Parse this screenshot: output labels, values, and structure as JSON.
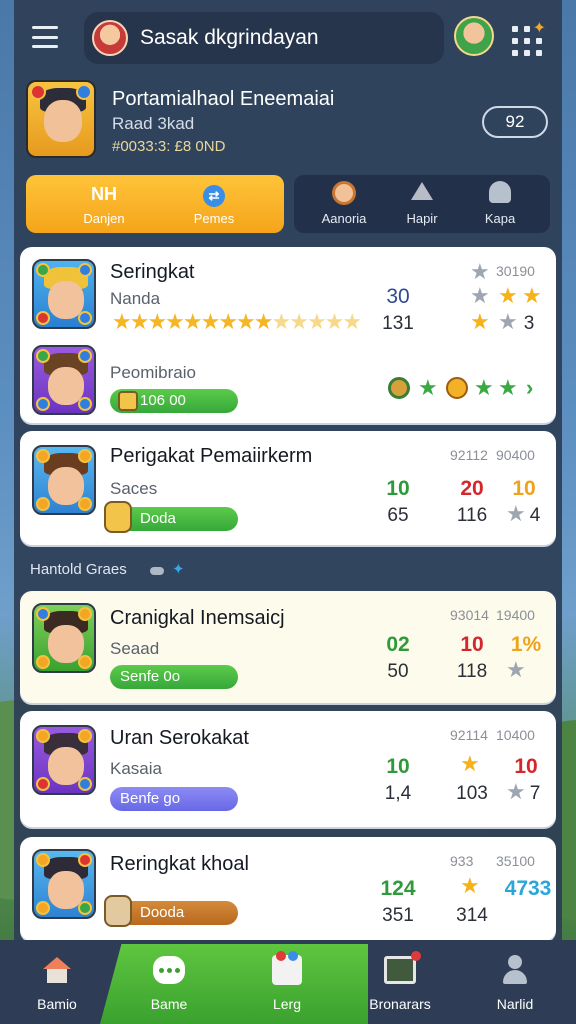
{
  "header": {
    "menu_icon": "hamburger-icon",
    "search_text": "Sasak dkgrindayan",
    "grid_icon": "grid-dots-icon"
  },
  "profile": {
    "name": "Portamialhaol Eneemaiai",
    "subtitle": "Raad 3kad",
    "stats": "#0033:3: £8 0ND",
    "score": "92"
  },
  "mode_tabs": {
    "active": [
      {
        "icon": "NH",
        "label": "Danjen"
      },
      {
        "icon": "⇄",
        "label": "Pemes"
      }
    ],
    "others": [
      {
        "label": "Aanoria"
      },
      {
        "label": "Hapir"
      },
      {
        "label": "Kapa"
      }
    ]
  },
  "cards": [
    {
      "title": "Seringkat",
      "subtitle": "Nanda",
      "n1": "30",
      "n2": "131",
      "top_right": "30190",
      "stars_rating": 10,
      "stars_value": "3"
    },
    {
      "subtitle": "Peomibraio",
      "pill": "106 00"
    },
    {
      "title": "Perigakat Pemaiirkerm",
      "subtitle": "Saces",
      "pill": "Doda",
      "tr1": "92112",
      "tr2": "90400",
      "a1": "10",
      "a2": "20",
      "a3": "10",
      "b1": "65",
      "b2": "116",
      "b3": "4"
    },
    {
      "title": "Cranigkal Inemsaicj",
      "subtitle": "Seaad",
      "pill": "Senfe 0o",
      "tr1": "93014",
      "tr2": "19400",
      "a1": "02",
      "a2": "10",
      "a3": "1%",
      "b1": "50",
      "b2": "118"
    },
    {
      "title": "Uran Serokakat",
      "subtitle": "Kasaia",
      "pill": "Benfe go",
      "tr1": "92114",
      "tr2": "10400",
      "a1": "10",
      "a3": "10",
      "b1": "1,4",
      "b2": "103",
      "b3": "7"
    },
    {
      "title": "Reringkat khoal",
      "pill": "Dooda",
      "tr1": "933",
      "tr2": "35100",
      "a1": "124",
      "a3": "4733",
      "b1": "351",
      "b2": "314"
    }
  ],
  "section_label": "Hantold Graes",
  "bottom_nav": [
    {
      "label": "Bamio",
      "icon": "house-icon"
    },
    {
      "label": "Bame",
      "icon": "chat-bubble-icon"
    },
    {
      "label": "Lerg",
      "icon": "map-icon"
    },
    {
      "label": "Bronarars",
      "icon": "picture-frame-icon"
    },
    {
      "label": "Narlid",
      "icon": "person-icon"
    }
  ],
  "colors": {
    "accent_orange": "#f5a41a",
    "accent_green": "#3aa12f",
    "panel": "#2e3e56"
  }
}
